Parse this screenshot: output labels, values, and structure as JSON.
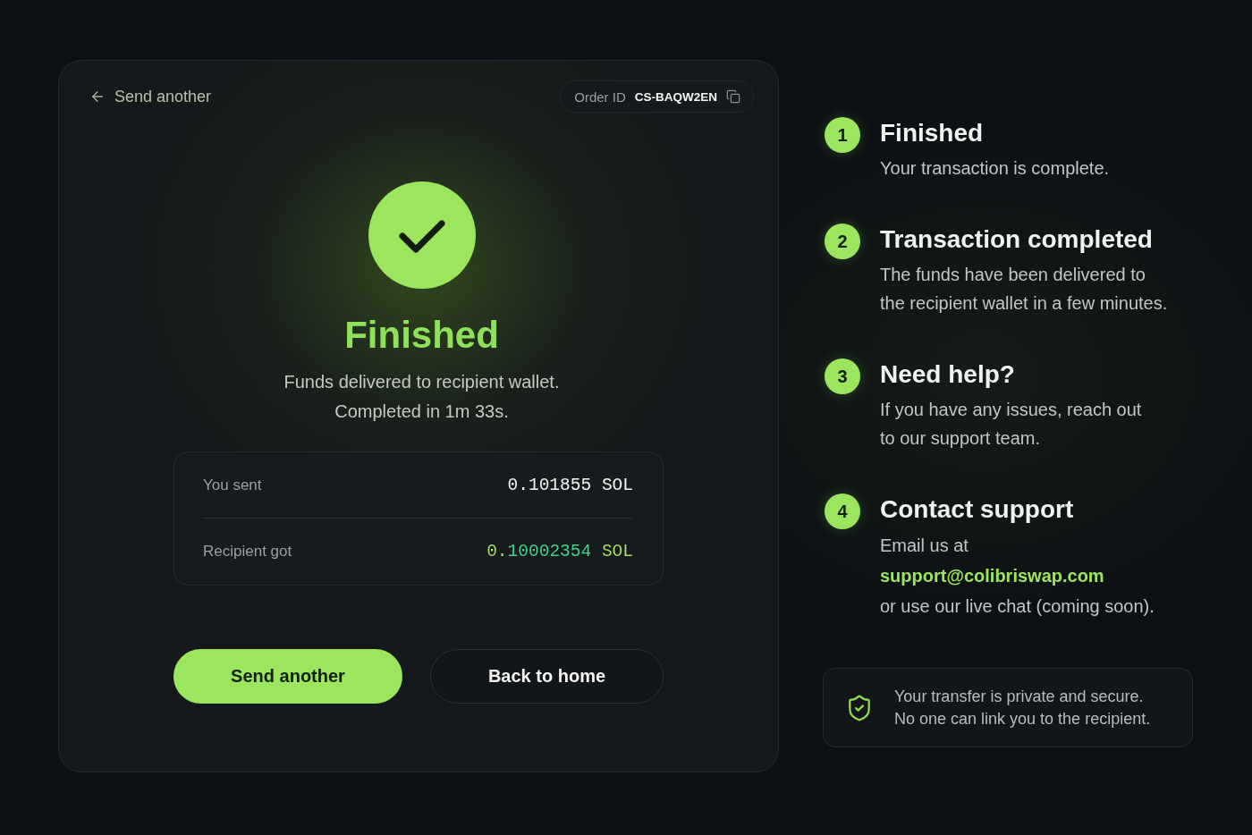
{
  "header": {
    "back_link": "Send another",
    "order_id": {
      "label": "Order ID",
      "value": "CS-BAQW2EN"
    }
  },
  "status": {
    "title": "Finished",
    "message": [
      "Funds delivered to recipient wallet.",
      "Completed in 1m 33s."
    ]
  },
  "summary": [
    {
      "label": "You sent",
      "value": "0.101855 SOL",
      "kind": "sent"
    },
    {
      "label": "Recipient got",
      "value": "0.10002354 SOL",
      "kind": "received"
    }
  ],
  "buttons": [
    {
      "label": "Send another",
      "kind": "primary"
    },
    {
      "label": "Back to home",
      "kind": "secondary"
    }
  ],
  "steps": [
    {
      "number": "1",
      "title": "Finished",
      "description": [
        {
          "text": "Your transaction is complete.",
          "kind": "text"
        }
      ]
    },
    {
      "number": "2",
      "title": "Transaction completed",
      "description": [
        {
          "text": "The funds have been delivered to",
          "kind": "text"
        },
        {
          "text": "the recipient wallet in a few minutes.",
          "kind": "text"
        }
      ]
    },
    {
      "number": "3",
      "title": "Need help?",
      "description": [
        {
          "text": "If you have any issues, reach out",
          "kind": "text"
        },
        {
          "text": "to our support team.",
          "kind": "text"
        }
      ]
    },
    {
      "number": "4",
      "title": "Contact support",
      "description": [
        {
          "text": "Email us at",
          "kind": "text"
        },
        {
          "text": "support@colibriswap.com",
          "kind": "link"
        },
        {
          "text": "or use our live chat (coming soon).",
          "kind": "text"
        }
      ]
    }
  ],
  "notice": {
    "lines": [
      "Your transfer is private and secure.",
      "No one can link you to the recipient."
    ]
  }
}
